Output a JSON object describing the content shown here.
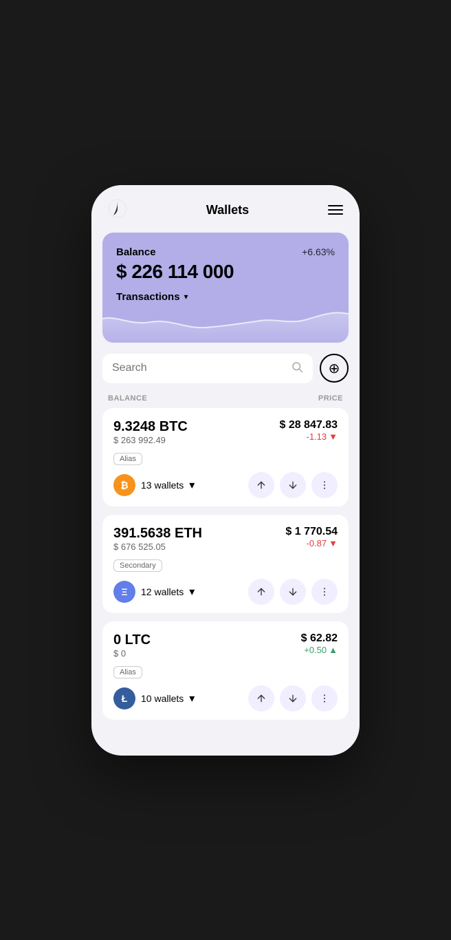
{
  "app": {
    "title": "Wallets"
  },
  "balance_card": {
    "label": "Balance",
    "change": "+6.63%",
    "amount": "$ 226 114 000",
    "transactions_label": "Transactions"
  },
  "search": {
    "placeholder": "Search"
  },
  "columns": {
    "balance": "BALANCE",
    "price": "PRICE"
  },
  "coins": [
    {
      "id": "btc",
      "amount": "9.3248 BTC",
      "usd_value": "$ 263 992.49",
      "price": "$ 28 847.83",
      "change": "-1.13",
      "change_type": "negative",
      "alias": "Alias",
      "wallets": "13 wallets",
      "logo_text": "₿",
      "logo_class": "btc-logo"
    },
    {
      "id": "eth",
      "amount": "391.5638 ETH",
      "usd_value": "$ 676 525.05",
      "price": "$ 1 770.54",
      "change": "-0.87",
      "change_type": "negative",
      "alias": "Secondary",
      "wallets": "12 wallets",
      "logo_text": "Ξ",
      "logo_class": "eth-logo"
    },
    {
      "id": "ltc",
      "amount": "0 LTC",
      "usd_value": "$ 0",
      "price": "$ 62.82",
      "change": "+0.50",
      "change_type": "positive",
      "alias": "Alias",
      "wallets": "10 wallets",
      "logo_text": "Ł",
      "logo_class": "ltc-logo"
    }
  ],
  "actions": {
    "send": "↑",
    "receive": "↓",
    "more": "⋮"
  }
}
